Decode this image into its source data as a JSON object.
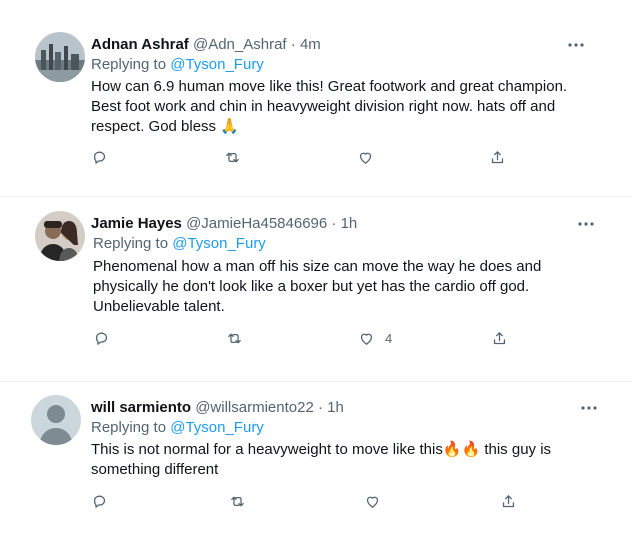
{
  "tweets": [
    {
      "name": "Adnan Ashraf",
      "handle": "@Adn_Ashraf",
      "time": "4m",
      "replying_prefix": "Replying to",
      "replying_to": "@Tyson_Fury",
      "text": "How can 6.9 human move like this! Great footwork and great champion. Best foot work and chin in heavyweight division right now. hats off and respect. God bless 🙏",
      "like_count": "",
      "avatar": "city-skyline-photo"
    },
    {
      "name": "Jamie Hayes",
      "handle": "@JamieHa45846696",
      "time": "1h",
      "replying_prefix": "Replying to",
      "replying_to": "@Tyson_Fury",
      "text": "Phenomenal how a man off his size can move the way he does and physically he don't look like a boxer but yet has the cardio off god. Unbelievable talent.",
      "like_count": "4",
      "avatar": "couple-photo"
    },
    {
      "name": "will sarmiento",
      "handle": "@willsarmiento22",
      "time": "1h",
      "replying_prefix": "Replying to",
      "replying_to": "@Tyson_Fury",
      "text": "This is not normal for a heavyweight to move like this🔥🔥 this guy is something different",
      "like_count": "",
      "avatar": "default-avatar"
    }
  ],
  "separator": "·",
  "colors": {
    "link": "#1d9bf0",
    "muted": "#536471",
    "divider": "#eff3f4"
  }
}
